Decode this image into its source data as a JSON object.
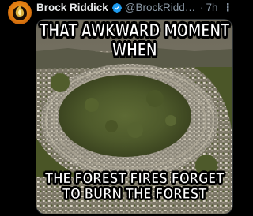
{
  "post": {
    "author": {
      "display_name": "Brock Riddick",
      "handle": "@BrockRiddick...",
      "verified": true,
      "avatar_icon": "ember-avatar-icon"
    },
    "separator": "·",
    "timestamp": "7h",
    "more_label": "⋮",
    "media": {
      "top_text": "THAT AWKWARD MOMENT WHEN",
      "bottom_text_line1": "THE FOREST FIRES FORGET",
      "bottom_text_line2": "TO BURN THE FOREST"
    }
  },
  "colors": {
    "background": "#000000",
    "primary_text": "#e7e9ea",
    "secondary_text": "#8b98a5",
    "verified_blue": "#1d9bf0",
    "avatar_orange": "#e07a10"
  }
}
